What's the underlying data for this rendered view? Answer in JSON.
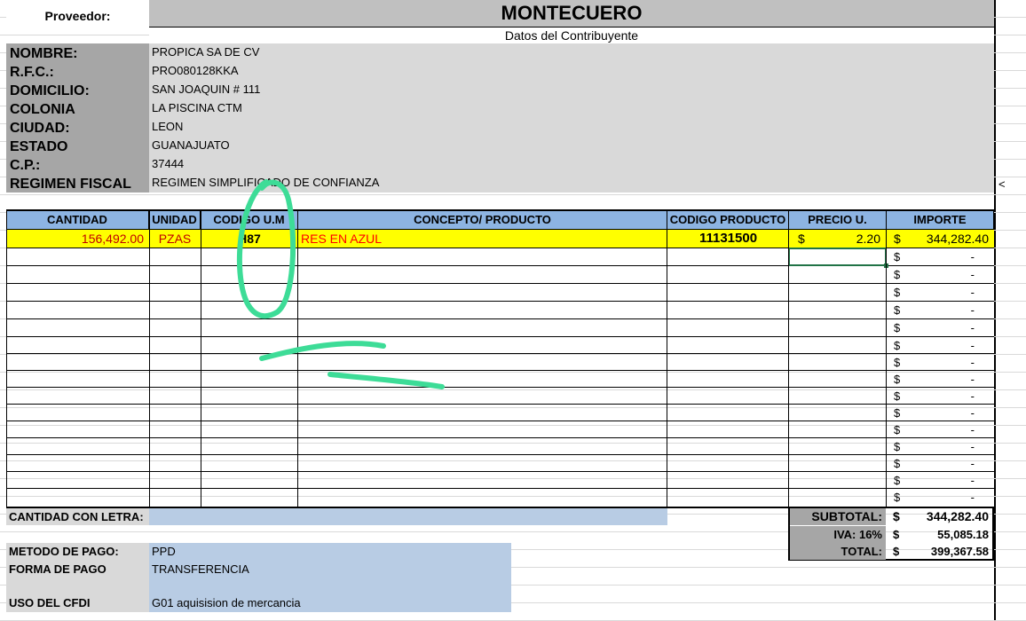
{
  "header": {
    "proveedor_label": "Proveedor:",
    "company": "MONTECUERO",
    "subtitle": "Datos del Contribuyente"
  },
  "taxpayer": [
    {
      "label": "NOMBRE:",
      "value": "PROPICA SA DE CV"
    },
    {
      "label": "R.F.C.:",
      "value": "PRO080128KKA"
    },
    {
      "label": "DOMICILIO:",
      "value": "SAN JOAQUIN # 111"
    },
    {
      "label": "COLONIA",
      "value": "LA PISCINA  CTM"
    },
    {
      "label": "CIUDAD:",
      "value": "LEON"
    },
    {
      "label": "ESTADO",
      "value": "GUANAJUATO"
    },
    {
      "label": "C.P.:",
      "value": "37444"
    },
    {
      "label": "REGIMEN FISCAL",
      "value": "REGIMEN SIMPLIFICADO DE CONFIANZA"
    }
  ],
  "side_mark": "<",
  "table": {
    "columns": [
      "CANTIDAD",
      "UNIDAD",
      "CODIGO U.M",
      "CONCEPTO/ PRODUCTO",
      "CODIGO PRODUCTO",
      "PRECIO U.",
      "IMPORTE"
    ],
    "row": {
      "cantidad": "156,492.00",
      "unidad": "PZAS",
      "codigo_um": "H87",
      "concepto": "RES EN AZUL",
      "codigo_producto": "11131500",
      "precio_symbol": "$",
      "precio": "2.20",
      "importe_symbol": "$",
      "importe": "344,282.40"
    },
    "empty_importe_symbol": "$",
    "empty_importe_value": "-"
  },
  "cantidad_con_letra": {
    "label": "CANTIDAD CON LETRA:",
    "value": ""
  },
  "totals": [
    {
      "label": "SUBTOTAL:",
      "symbol": "$",
      "value": "344,282.40"
    },
    {
      "label": "IVA: 16%",
      "symbol": "$",
      "value": "55,085.18"
    },
    {
      "label": "TOTAL:",
      "symbol": "$",
      "value": "399,367.58"
    }
  ],
  "payment": [
    {
      "label": "METODO DE PAGO:",
      "value": "PPD"
    },
    {
      "label": "FORMA DE PAGO",
      "value": "TRANSFERENCIA"
    },
    {
      "label": "USO DEL CFDI",
      "value": "G01  aquisision de mercancia"
    }
  ],
  "colors": {
    "header_grey": "#c0c0c0",
    "panel_grey": "#d9d9d9",
    "label_grey": "#a6a6a6",
    "table_header_blue": "#8db4e2",
    "highlight_yellow": "#ffff00",
    "light_blue": "#b8cce4",
    "annotation_green": "#3ddc97",
    "concept_red": "#ff0000"
  }
}
